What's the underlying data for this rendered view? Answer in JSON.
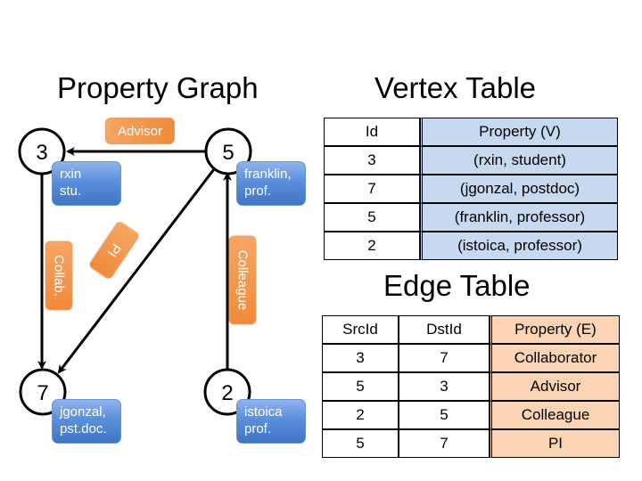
{
  "graph": {
    "title": "Property Graph",
    "vertices": [
      {
        "id": "3",
        "label_line1": "rxin",
        "label_line2": "stu."
      },
      {
        "id": "5",
        "label_line1": "franklin,",
        "label_line2": "prof."
      },
      {
        "id": "7",
        "label_line1": "jgonzal,",
        "label_line2": "pst.doc."
      },
      {
        "id": "2",
        "label_line1": "istoica",
        "label_line2": "prof."
      }
    ],
    "edge_labels": {
      "advisor": "Advisor",
      "collab": "Collab.",
      "pi": "PI",
      "colleague": "Colleague"
    }
  },
  "vertex_table": {
    "title": "Vertex Table",
    "headers": [
      "Id",
      "Property (V)"
    ],
    "rows": [
      [
        "3",
        "(rxin, student)"
      ],
      [
        "7",
        "(jgonzal, postdoc)"
      ],
      [
        "5",
        "(franklin, professor)"
      ],
      [
        "2",
        "(istoica, professor)"
      ]
    ]
  },
  "edge_table": {
    "title": "Edge Table",
    "headers": [
      "SrcId",
      "DstId",
      "Property (E)"
    ],
    "rows": [
      [
        "3",
        "7",
        "Collaborator"
      ],
      [
        "5",
        "3",
        "Advisor"
      ],
      [
        "2",
        "5",
        "Colleague"
      ],
      [
        "5",
        "7",
        "PI"
      ]
    ]
  }
}
